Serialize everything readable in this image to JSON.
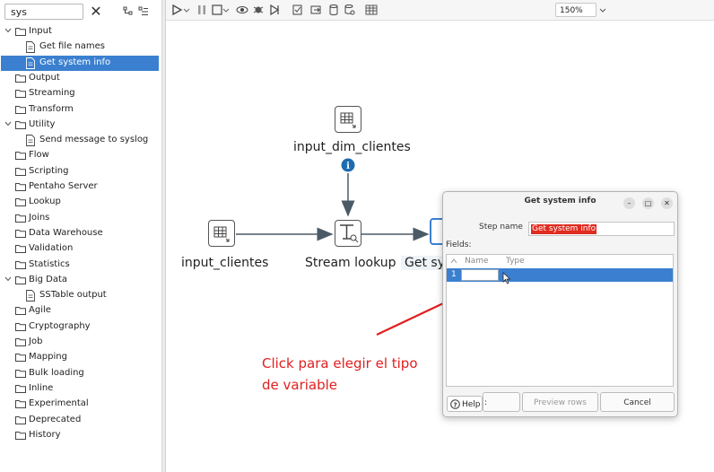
{
  "search": {
    "value": "sys",
    "clear_glyph": "✕"
  },
  "tree": [
    {
      "kind": "folder",
      "label": "Input",
      "expanded": true
    },
    {
      "kind": "leaf",
      "label": "Get file names",
      "icon": "file-names-icon"
    },
    {
      "kind": "leaf",
      "label": "Get system info",
      "icon": "system-info-icon",
      "selected": true
    },
    {
      "kind": "folder",
      "label": "Output"
    },
    {
      "kind": "folder",
      "label": "Streaming"
    },
    {
      "kind": "folder",
      "label": "Transform"
    },
    {
      "kind": "folder",
      "label": "Utility",
      "expanded": true
    },
    {
      "kind": "leaf",
      "label": "Send message to syslog",
      "icon": "syslog-icon"
    },
    {
      "kind": "folder",
      "label": "Flow"
    },
    {
      "kind": "folder",
      "label": "Scripting"
    },
    {
      "kind": "folder",
      "label": "Pentaho Server"
    },
    {
      "kind": "folder",
      "label": "Lookup"
    },
    {
      "kind": "folder",
      "label": "Joins"
    },
    {
      "kind": "folder",
      "label": "Data Warehouse"
    },
    {
      "kind": "folder",
      "label": "Validation"
    },
    {
      "kind": "folder",
      "label": "Statistics"
    },
    {
      "kind": "folder",
      "label": "Big Data",
      "expanded": true
    },
    {
      "kind": "leaf",
      "label": "SSTable output",
      "icon": "sstable-icon"
    },
    {
      "kind": "folder",
      "label": "Agile"
    },
    {
      "kind": "folder",
      "label": "Cryptography"
    },
    {
      "kind": "folder",
      "label": "Job"
    },
    {
      "kind": "folder",
      "label": "Mapping"
    },
    {
      "kind": "folder",
      "label": "Bulk loading"
    },
    {
      "kind": "folder",
      "label": "Inline"
    },
    {
      "kind": "folder",
      "label": "Experimental"
    },
    {
      "kind": "folder",
      "label": "Deprecated"
    },
    {
      "kind": "folder",
      "label": "History"
    }
  ],
  "toolbar": {
    "zoom": "150%"
  },
  "canvas": {
    "steps": {
      "input_dim": "input_dim_clientes",
      "input_cli": "input_clientes",
      "stream_lookup": "Stream lookup",
      "get_sys": "Get sys"
    }
  },
  "dialog": {
    "title": "Get system info",
    "stepname_label": "Step name",
    "stepname_value": "Get system info",
    "fields_label": "Fields:",
    "columns": {
      "name": "Name",
      "type": "Type"
    },
    "row_number": "1",
    "buttons": {
      "help": "Help",
      "ok": ":",
      "preview": "Preview rows",
      "cancel": "Cancel"
    }
  },
  "annotation": {
    "line1": "Click para elegir el tipo",
    "line2": "de variable",
    "color": "#e02020"
  },
  "colors": {
    "selection": "#3b80d0",
    "accent_red": "#e02b20"
  }
}
